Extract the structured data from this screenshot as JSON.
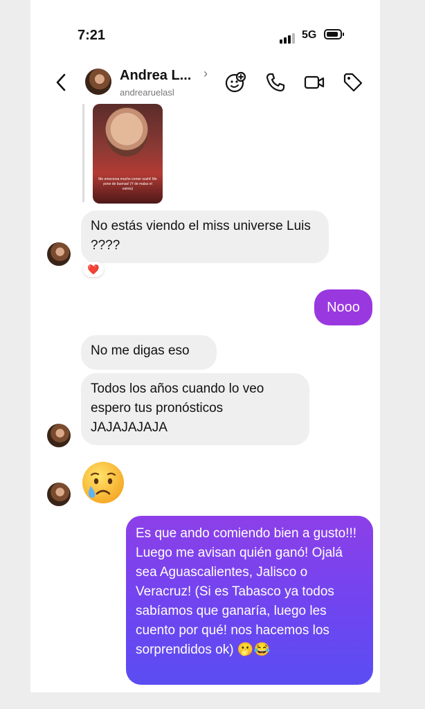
{
  "status_bar": {
    "time": "7:21",
    "network": "5G"
  },
  "header": {
    "name": "Andrea L...",
    "username": "andrearuelasl",
    "icons": [
      "sticker-icon",
      "phone-icon",
      "video-icon",
      "tag-icon"
    ]
  },
  "story": {
    "caption": "Me emociona mucho comer sushi! Me pone de buenas! (Y de malas el estrés)"
  },
  "messages": [
    {
      "from": "them",
      "text": "No estás viendo el miss universe Luis ????",
      "reaction": "❤️"
    },
    {
      "from": "me",
      "text": "Nooo"
    },
    {
      "from": "them",
      "text": "No me digas eso"
    },
    {
      "from": "them",
      "text": "Todos los años cuando lo veo espero tus pronósticos JAJAJAJAJA"
    },
    {
      "from": "them",
      "emoji": "crying-face"
    },
    {
      "from": "me",
      "text": "Es que ando comiendo bien a gusto!!! Luego me avisan quién ganó! Ojalá sea Aguascalientes, Jalisco o Veracruz! (Si es Tabasco ya todos sabíamos que ganaría, luego les cuento por qué! nos hacemos los sorprendidos ok) 🫢😂"
    }
  ],
  "colors": {
    "outgoing_bubble": "#9a38e0",
    "incoming_bubble": "#efefef"
  }
}
